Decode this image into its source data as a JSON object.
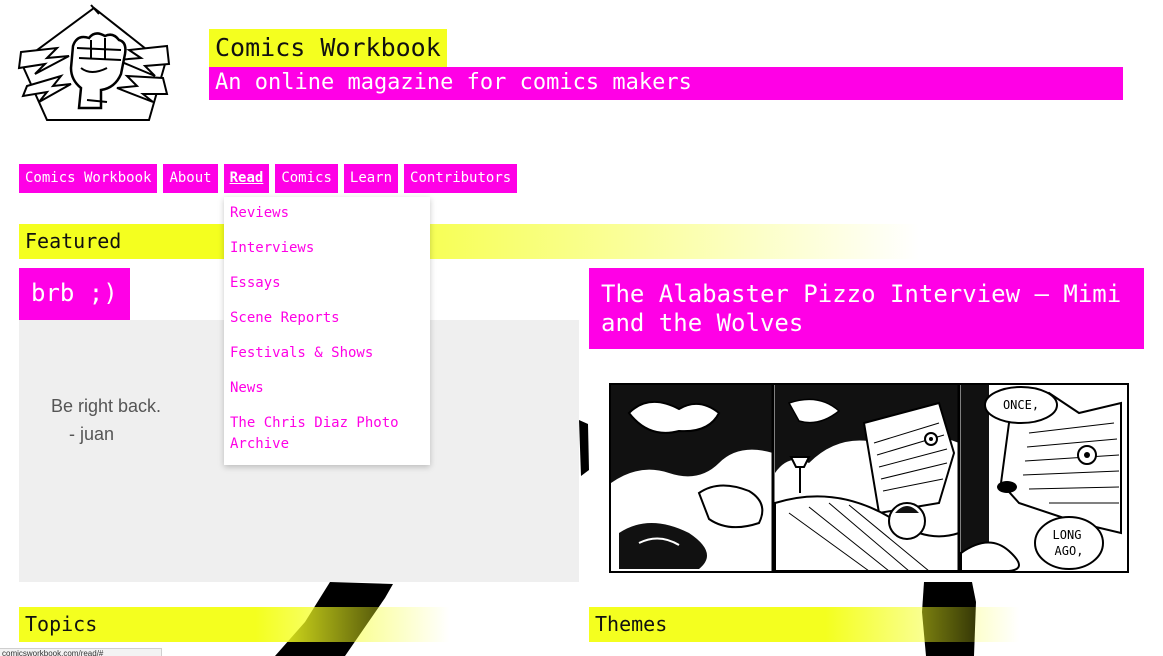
{
  "header": {
    "title": "Comics Workbook",
    "tagline": "An online magazine for comics makers",
    "logo_icon": "fist-lightning-icon"
  },
  "nav": {
    "items": [
      {
        "label": "Comics Workbook"
      },
      {
        "label": "About"
      },
      {
        "label": "Read"
      },
      {
        "label": "Comics"
      },
      {
        "label": "Learn"
      },
      {
        "label": "Contributors"
      }
    ],
    "active": "Read"
  },
  "dropdown": {
    "items": [
      {
        "label": "Reviews"
      },
      {
        "label": "Interviews"
      },
      {
        "label": "Essays"
      },
      {
        "label": "Scene Reports"
      },
      {
        "label": "Festivals & Shows"
      },
      {
        "label": "News"
      },
      {
        "label": "The Chris Diaz Photo Archive"
      }
    ]
  },
  "featured": {
    "label": "Featured",
    "left": {
      "title": "brb ;)",
      "image_text_line1": "Be right back.",
      "image_text_line2": "-   juan"
    },
    "right": {
      "title": "The Alabaster Pizzo Interview – Mimi and the Wolves",
      "comic_text_1": "ONCE,",
      "comic_text_2": "LONG",
      "comic_text_3": "AGO,"
    }
  },
  "sections": {
    "topics": "Topics",
    "themes": "Themes"
  },
  "status": {
    "url": "comicsworkbook.com/read/#"
  },
  "colors": {
    "magenta": "#ff00e6",
    "yellow": "#f4ff1f"
  }
}
